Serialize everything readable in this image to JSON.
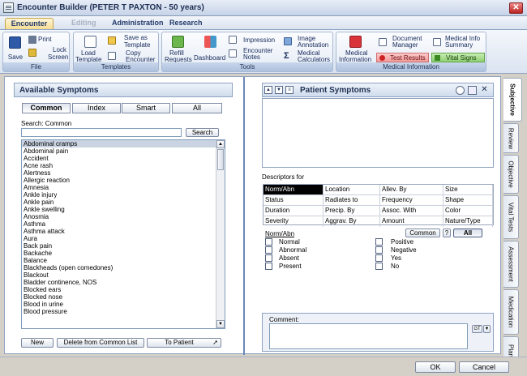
{
  "window": {
    "title": "Encounter Builder (PETER T PAXTON - 50 years)",
    "close_glyph": "✕"
  },
  "menu_tabs": [
    {
      "label": "Encounter"
    },
    {
      "label": "Editing"
    },
    {
      "label": "Administration"
    },
    {
      "label": "Research"
    }
  ],
  "ribbon": {
    "groups": [
      {
        "label": "File"
      },
      {
        "label": "Templates"
      },
      {
        "label": "Tools"
      },
      {
        "label": "Medical Information"
      }
    ],
    "file": {
      "save": "Save",
      "print": "Print",
      "lock_screen_1": "Lock",
      "lock_screen_2": "Screen"
    },
    "templates": {
      "load_1": "Load",
      "load_2": "Template",
      "save_as_1": "Save as",
      "save_as_2": "Template",
      "copy_1": "Copy",
      "copy_2": "Encounter"
    },
    "tools": {
      "refill_1": "Refill",
      "refill_2": "Requests",
      "dashboard": "Dashboard",
      "impression": "Impression",
      "notes_1": "Encounter",
      "notes_2": "Notes",
      "image_1": "Image",
      "image_2": "Annotation",
      "calc_1": "Medical",
      "calc_2": "Calculators"
    },
    "medical": {
      "info_1": "Medical",
      "info_2": "Information",
      "doc_1": "Document",
      "doc_2": "Manager",
      "test_results": "Test Results",
      "summary_1": "Medical Info",
      "summary_2": "Summary",
      "vital_signs": "Vital Signs"
    }
  },
  "available_symptoms": {
    "title": "Available Symptoms",
    "segments": [
      "Common",
      "Index",
      "Smart",
      "All"
    ],
    "search_label": "Search: Common",
    "search_value": "",
    "search_button": "Search",
    "items": [
      "Abdominal cramps",
      "Abdominal pain",
      "Accident",
      "Acne rash",
      "Alertness",
      "Allergic reaction",
      "Amnesia",
      "Ankle injury",
      "Ankle pain",
      "Ankle swelling",
      "Anosmia",
      "Asthma",
      "Asthma attack",
      "Aura",
      "Back pain",
      "Backache",
      "Balance",
      "Blackheads (open comedones)",
      "Blackout",
      "Bladder continence, NOS",
      "Blocked ears",
      "Blocked nose",
      "Blood in urine",
      "Blood pressure"
    ],
    "buttons": {
      "new": "New",
      "delete": "Delete from Common List",
      "to_patient": "To Patient"
    }
  },
  "patient_symptoms": {
    "title": "Patient Symptoms",
    "descriptors_label": "Descriptors for",
    "descriptor_rows": [
      [
        "Norm/Abn",
        "Location",
        "Allev. By",
        "Size"
      ],
      [
        "Status",
        "Radiates to",
        "Frequency",
        "Shape"
      ],
      [
        "Duration",
        "Precip. By",
        "Assoc. With",
        "Color"
      ],
      [
        "Severity",
        "Aggrav. By",
        "Amount",
        "Nature/Type"
      ]
    ],
    "current_descriptor": "Norm/Abn",
    "common_button": "Common",
    "help_button": "?",
    "all_button": "All",
    "left_options": [
      "Normal",
      "Abnormal",
      "Absent",
      "Present"
    ],
    "right_options": [
      "Positive",
      "Negative",
      "Yes",
      "No"
    ],
    "comment_label": "Comment:",
    "gt_button": "GT"
  },
  "side_tabs": [
    "Subjective",
    "Review",
    "Objective",
    "Vital Tests",
    "Assessment",
    "Medication",
    "Plan"
  ],
  "footer": {
    "ok": "OK",
    "cancel": "Cancel"
  }
}
